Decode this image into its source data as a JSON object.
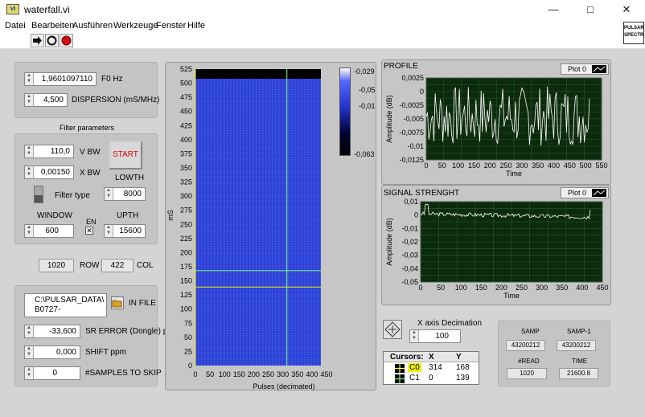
{
  "window": {
    "title": "waterfall.vi",
    "icon_text": "VI",
    "controls": [
      "minimize-icon",
      "maximize-icon",
      "close-icon"
    ]
  },
  "menu": [
    "Datei",
    "Bearbeiten",
    "Ausführen",
    "Werkzeuge",
    "Fenster",
    "Hilfe"
  ],
  "toolbar": {
    "buttons": [
      "run-arrow-icon",
      "run-continuously-icon",
      "abort-icon"
    ],
    "vi_icon_lines": [
      "PULSAR",
      "SPECTR"
    ]
  },
  "controls": {
    "f0": {
      "value": "1,9601097110",
      "label": "F0 Hz"
    },
    "dispersion": {
      "value": "4,500",
      "label": "DISPERSION (mS/MHz)"
    },
    "filter_title": "Filter parameters",
    "vbw": {
      "value": "110,0",
      "label": "V BW"
    },
    "xbw": {
      "value": "0,00150",
      "label": "X BW"
    },
    "start_label": "START",
    "filter_type_label": "Filter type",
    "lowth": {
      "label": "LOWTH",
      "value": "8000"
    },
    "window": {
      "label": "WINDOW",
      "value": "600"
    },
    "en_label": "EN",
    "upth": {
      "label": "UPTH",
      "value": "15600"
    },
    "row": {
      "value": "1020",
      "label": "ROW"
    },
    "col": {
      "value": "422",
      "label": "COL"
    },
    "infile": {
      "value_line1": "C:\\PULSAR_DATA\\",
      "value_line2": "B0727-",
      "label": "IN FILE"
    },
    "sr_error": {
      "value": "-33,600",
      "label": "SR ERROR (Dongle) ppm"
    },
    "shift": {
      "value": "0,000",
      "label": "SHIFT ppm"
    },
    "samples_skip": {
      "value": "0",
      "label": "#SAMPLES TO SKIP"
    },
    "x_decimation": {
      "label": "X axis Decimation",
      "value": "100"
    }
  },
  "waterfall": {
    "ylabel": "mS",
    "xlabel": "Pulses (decimated)",
    "yticks": [
      "0",
      "25",
      "50",
      "75",
      "100",
      "125",
      "150",
      "175",
      "200",
      "225",
      "250",
      "275",
      "300",
      "325",
      "350",
      "375",
      "400",
      "425",
      "450",
      "475",
      "500",
      "525"
    ],
    "xticks": [
      "0",
      "50",
      "100",
      "150",
      "200",
      "250",
      "300",
      "350",
      "400",
      "450"
    ],
    "colorbar_ticks": [
      "-0,029",
      "-0,05",
      "-0,01",
      "-0,063"
    ],
    "cursor_hline_values": [
      139,
      168
    ],
    "cursor_vline_value": 314
  },
  "profile": {
    "title": "PROFILE",
    "plot_legend": "Plot 0",
    "ylabel": "Amplitude (dB)",
    "xlabel": "Time",
    "yticks": [
      "0,0025",
      "0",
      "-0,0025",
      "-0,005",
      "-0,0075",
      "-0,01",
      "-0,0125"
    ],
    "xticks": [
      "0",
      "50",
      "100",
      "150",
      "200",
      "250",
      "300",
      "350",
      "400",
      "450",
      "500",
      "550"
    ]
  },
  "signal": {
    "title": "SIGNAL STRENGHT",
    "plot_legend": "Plot 0",
    "ylabel": "Amplitude (dB)",
    "xlabel": "Time",
    "yticks": [
      "0,01",
      "0",
      "-0,01",
      "-0,02",
      "-0,03",
      "-0,04",
      "-0,05"
    ],
    "xticks": [
      "0",
      "50",
      "100",
      "150",
      "200",
      "250",
      "300",
      "350",
      "400",
      "450"
    ]
  },
  "cursors": {
    "headers": [
      "Cursors:",
      "X",
      "Y"
    ],
    "rows": [
      {
        "name": "C0",
        "x": "314",
        "y": "168"
      },
      {
        "name": "C1",
        "x": "0",
        "y": "139"
      }
    ]
  },
  "stats": {
    "samp_label": "SAMP",
    "samp": "43200212",
    "samp1_label": "SAMP-1",
    "samp1": "43200212",
    "read_label": "#READ",
    "read": "1020",
    "time_label": "TIME",
    "time": "21600.8"
  },
  "colors": {
    "panel": "#d4d4d4",
    "plot_bg": "#0c2a0c",
    "waterfall_blue": "#2f45d8",
    "cursor_yellow": "#f0f000",
    "cursor_green": "#7cff7c"
  }
}
